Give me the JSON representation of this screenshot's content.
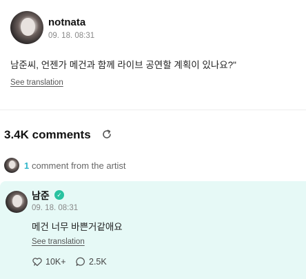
{
  "post": {
    "author": "notnata",
    "date": "09. 18. 08:31",
    "text": "남준씨, 언젠가 메건과 함께 라이브 공연할 계획이 있나요?\"",
    "translation_link": "See translation"
  },
  "comments": {
    "title": "3.4K comments",
    "refresh_icon": "refresh-icon"
  },
  "artist_summary": {
    "count": "1",
    "label": "comment from the artist"
  },
  "artist_comment": {
    "author": "남준",
    "verified_icon": "check-badge-icon",
    "date": "09. 18. 08:31",
    "text": "메건 너무 바쁜거같애요",
    "translation_link": "See translation",
    "likes": "10K+",
    "replies": "2.5K"
  },
  "colors": {
    "accent": "#2fb5c8",
    "verified": "#29c2a0",
    "card_background": "#e6f9f6"
  }
}
